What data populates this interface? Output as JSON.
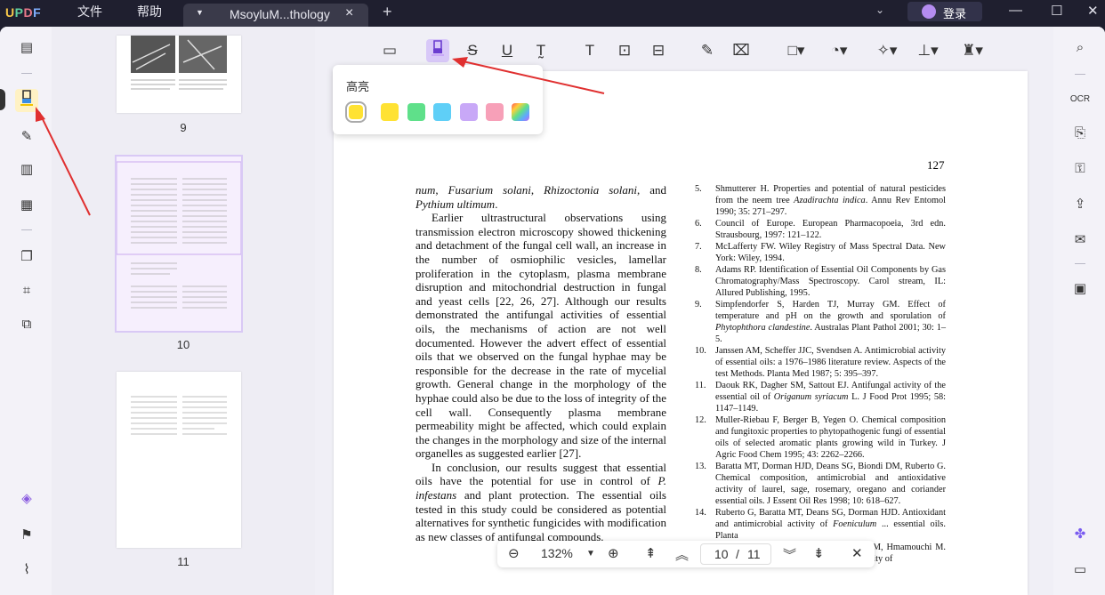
{
  "app": {
    "logo": "UPDF",
    "menu": [
      "文件",
      "帮助"
    ],
    "tab_name": "MsoyluM...thology",
    "login": "登录"
  },
  "highlight_popup": {
    "label": "高亮",
    "colors": [
      "#ffe233",
      "#ffe233",
      "#5fe08a",
      "#5fcff7",
      "#c8a8f7",
      "#f7a0b8",
      "rainbow"
    ],
    "selected_index": 0
  },
  "thumbnails": [
    {
      "label": "9"
    },
    {
      "label": "10"
    },
    {
      "label": "11"
    }
  ],
  "page": {
    "number": "127",
    "left_paragraphs": [
      {
        "type": "cont",
        "html": "<i>num</i>, <i>Fusarium solani</i>, <i>Rhizoctonia solani</i>, and <i>Pythium ultimum</i>."
      },
      {
        "type": "para",
        "html": "Earlier ultrastructural observations using transmission electron microscopy showed thickening and detachment of the fungal cell wall, an increase in the number of osmiophilic vesicles, lamellar proliferation in the cytoplasm, plasma membrane disruption and mitochondrial destruction in fungal and yeast cells [22, 26, 27]. Although our results demonstrated the antifungal activities of essential oils, the mechanisms of action are not well documented. However the advert effect of essential oils that we observed on the fungal hyphae may be responsible for the decrease in the rate of mycelial growth. General change in the morphology of the hyphae could also be due to the loss of integrity of the cell wall. Consequently plasma membrane permeability might be affected, which could explain the changes in the morphology and size of the internal organelles as suggested earlier [27]."
      },
      {
        "type": "para",
        "html": "In conclusion, our results suggest that essential oils have the potential for use in control of <i>P. infestans</i> and plant protection. The essential oils tested in this study could be considered as potential alternatives for synthetic fungicides with modification as new classes of antifungal compounds."
      }
    ],
    "references": [
      {
        "n": "5.",
        "html": "Shmutterer H. Properties and potential of natural pesticides from the neem tree <i>Azadirachta indica</i>. Annu Rev Entomol 1990; 35: 271–297."
      },
      {
        "n": "6.",
        "html": "Council of Europe. European Pharmacopoeia, 3rd edn. Strausbourg, 1997: 121–122."
      },
      {
        "n": "7.",
        "html": "McLafferty FW. Wiley Registry of Mass Spectral Data. New York: Wiley, 1994."
      },
      {
        "n": "8.",
        "html": "Adams RP. Identification of Essential Oil Components by Gas Chromatography/Mass Spectroscopy. Carol stream, IL: Allured Publishing, 1995."
      },
      {
        "n": "9.",
        "html": "Simpfendorfer S, Harden TJ, Murray GM. Effect of temperature and pH on the growth and sporulation of <i>Phytophthora clandestine</i>. Australas Plant Pathol 2001; 30: 1–5."
      },
      {
        "n": "10.",
        "html": "Janssen AM, Scheffer JJC, Svendsen A. Antimicrobial activity of essential oils: a 1976–1986 literature review. Aspects of the test Methods. Planta Med 1987; 5: 395–397."
      },
      {
        "n": "11.",
        "html": "Daouk RK, Dagher SM, Sattout EJ. Antifungal activity of the essential oil of <i>Origanum syriacum</i> L. J Food Prot 1995; 58: 1147–1149."
      },
      {
        "n": "12.",
        "html": "Muller-Riebau F, Berger B, Yegen O. Chemical composition and fungitoxic properties to phytopathogenic fungi of essential oils of selected aromatic plants growing wild in Turkey. J Agric Food Chem 1995; 43: 2262–2266."
      },
      {
        "n": "13.",
        "html": "Baratta MT, Dorman HJD, Deans SG, Biondi DM, Ruberto G. Chemical composition, antimicrobial and antioxidative activity of laurel, sage, rosemary, oregano and coriander essential oils. J Essent Oil Res 1998; 10: 618–627."
      },
      {
        "n": "14.",
        "html": "Ruberto G, Baratta MT, Deans SG, Dorman HJD. Antioxidant and antimicrobial activity of <i>Foeniculum</i> ... essential oils. Planta"
      },
      {
        "n": "15.",
        "html": "Bouchra C, Achouri M, Idrissi-Hassani LM, Hmamouchi M. Chemical composition and antifungal activity of"
      }
    ]
  },
  "zoom": {
    "level": "132%",
    "current_page": "10",
    "separator": "/",
    "total_pages": "11"
  }
}
